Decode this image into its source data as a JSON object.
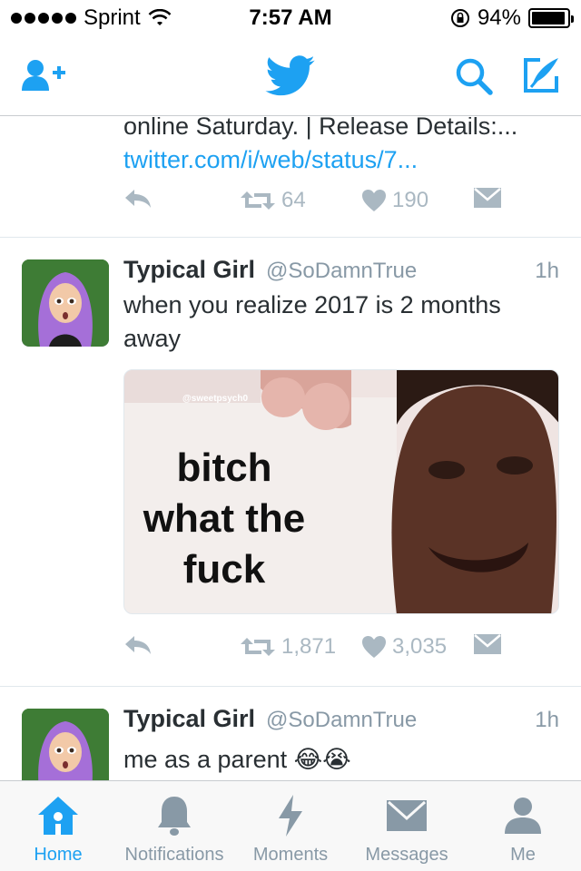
{
  "status_bar": {
    "carrier": "Sprint",
    "time": "7:57 AM",
    "battery_text": "94%",
    "battery_level": 0.94
  },
  "nav": {
    "icons": [
      "add-user-icon",
      "twitter-bird-icon",
      "search-icon",
      "compose-icon"
    ],
    "accent_color": "#1da1f2"
  },
  "tweets": [
    {
      "text_line": "online Saturday. | Release Details:...",
      "link": "twitter.com/i/web/status/7...",
      "retweets": "64",
      "likes": "190"
    },
    {
      "name": "Typical Girl",
      "handle": "@SoDamnTrue",
      "time": "1h",
      "text": "when you realize 2017 is 2 months away",
      "media": {
        "watermark": "@sweetpsych0",
        "caption_lines": [
          "bitch",
          "what the",
          "fuck"
        ]
      },
      "retweets": "1,871",
      "likes": "3,035"
    },
    {
      "name": "Typical Girl",
      "handle": "@SoDamnTrue",
      "time": "1h",
      "text": "me as a parent 😂😭"
    }
  ],
  "tabs": [
    {
      "label": "Home",
      "icon": "home-icon",
      "active": true
    },
    {
      "label": "Notifications",
      "icon": "bell-icon",
      "active": false
    },
    {
      "label": "Moments",
      "icon": "lightning-icon",
      "active": false
    },
    {
      "label": "Messages",
      "icon": "envelope-icon",
      "active": false
    },
    {
      "label": "Me",
      "icon": "person-icon",
      "active": false
    }
  ]
}
